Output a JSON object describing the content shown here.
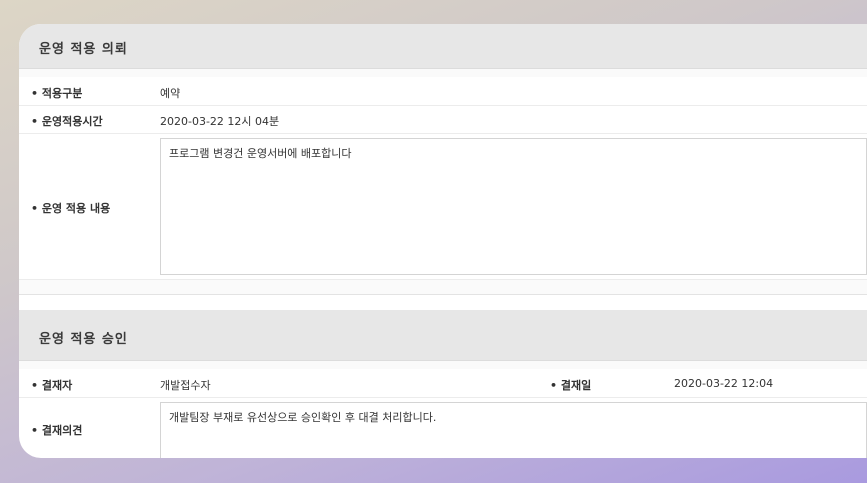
{
  "request": {
    "title": "운영 적용 의뢰",
    "apply_type_label": "• 적용구분",
    "apply_type_value": "예약",
    "apply_time_label": "• 운영적용시간",
    "apply_time_value": "2020-03-22  12시 04분",
    "content_label": "• 운영 적용 내용",
    "content_value": "프로그램 변경건 운영서버에 배포합니다"
  },
  "approval": {
    "title": "운영 적용 승인",
    "approver_label": "• 결재자",
    "approver_value": "개발접수자",
    "date_label": "• 결재일",
    "date_value": "2020-03-22 12:04",
    "opinion_label": "• 결재의견",
    "opinion_value": "개발팀장 부재로 유선상으로 승인확인 후 대결 처리합니다."
  }
}
